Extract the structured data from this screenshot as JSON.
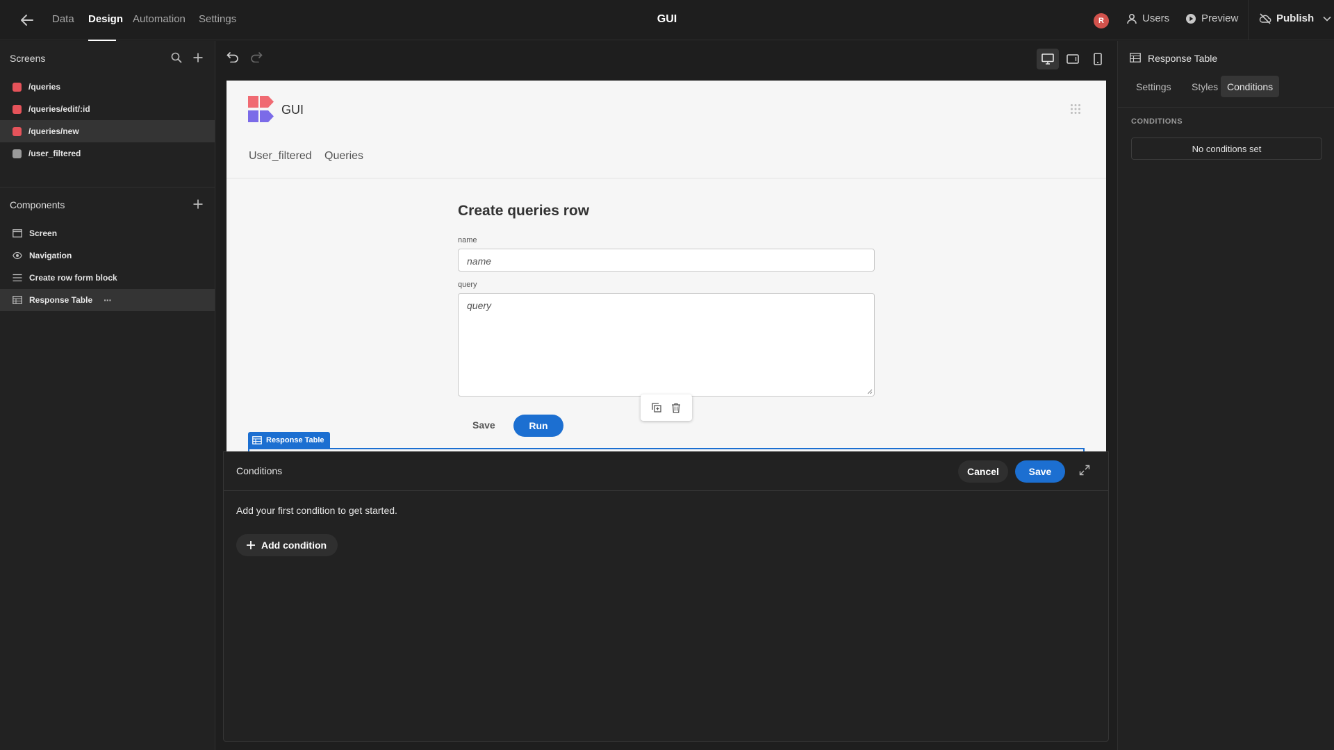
{
  "topbar": {
    "tabs": [
      "Data",
      "Design",
      "Automation",
      "Settings"
    ],
    "active_tab": "Design",
    "title": "GUI",
    "avatar_initial": "R",
    "users_label": "Users",
    "preview_label": "Preview",
    "publish_label": "Publish"
  },
  "screens": {
    "heading": "Screens",
    "items": [
      {
        "label": "/queries",
        "color": "#e5535a"
      },
      {
        "label": "/queries/edit/:id",
        "color": "#e5535a"
      },
      {
        "label": "/queries/new",
        "color": "#e5535a"
      },
      {
        "label": "/user_filtered",
        "color": "#9a9a9a"
      }
    ],
    "selected": "/queries/new"
  },
  "components": {
    "heading": "Components",
    "items": [
      "Screen",
      "Navigation",
      "Create row form block",
      "Response Table"
    ],
    "selected": "Response Table",
    "more_label": "···"
  },
  "preview": {
    "app_name": "GUI",
    "nav_links": [
      "User_filtered",
      "Queries"
    ],
    "form_title": "Create queries row",
    "fields": [
      {
        "label": "name",
        "placeholder": "name"
      },
      {
        "label": "query",
        "placeholder": "query"
      }
    ],
    "save_label": "Save",
    "run_label": "Run",
    "selected_component_badge": "Response Table"
  },
  "conditions_drawer": {
    "title": "Conditions",
    "cancel_label": "Cancel",
    "save_label": "Save",
    "empty_message": "Add your first condition to get started.",
    "add_label": "Add condition"
  },
  "right_panel": {
    "title": "Response Table",
    "tabs": [
      "Settings",
      "Styles",
      "Conditions"
    ],
    "active_tab": "Conditions",
    "section_label": "CONDITIONS",
    "no_conditions_label": "No conditions set"
  },
  "colors": {
    "accent": "#1c6fd1",
    "screen_red": "#e5535a",
    "logo_pink": "#f06a72",
    "logo_purple": "#7b6be8"
  }
}
